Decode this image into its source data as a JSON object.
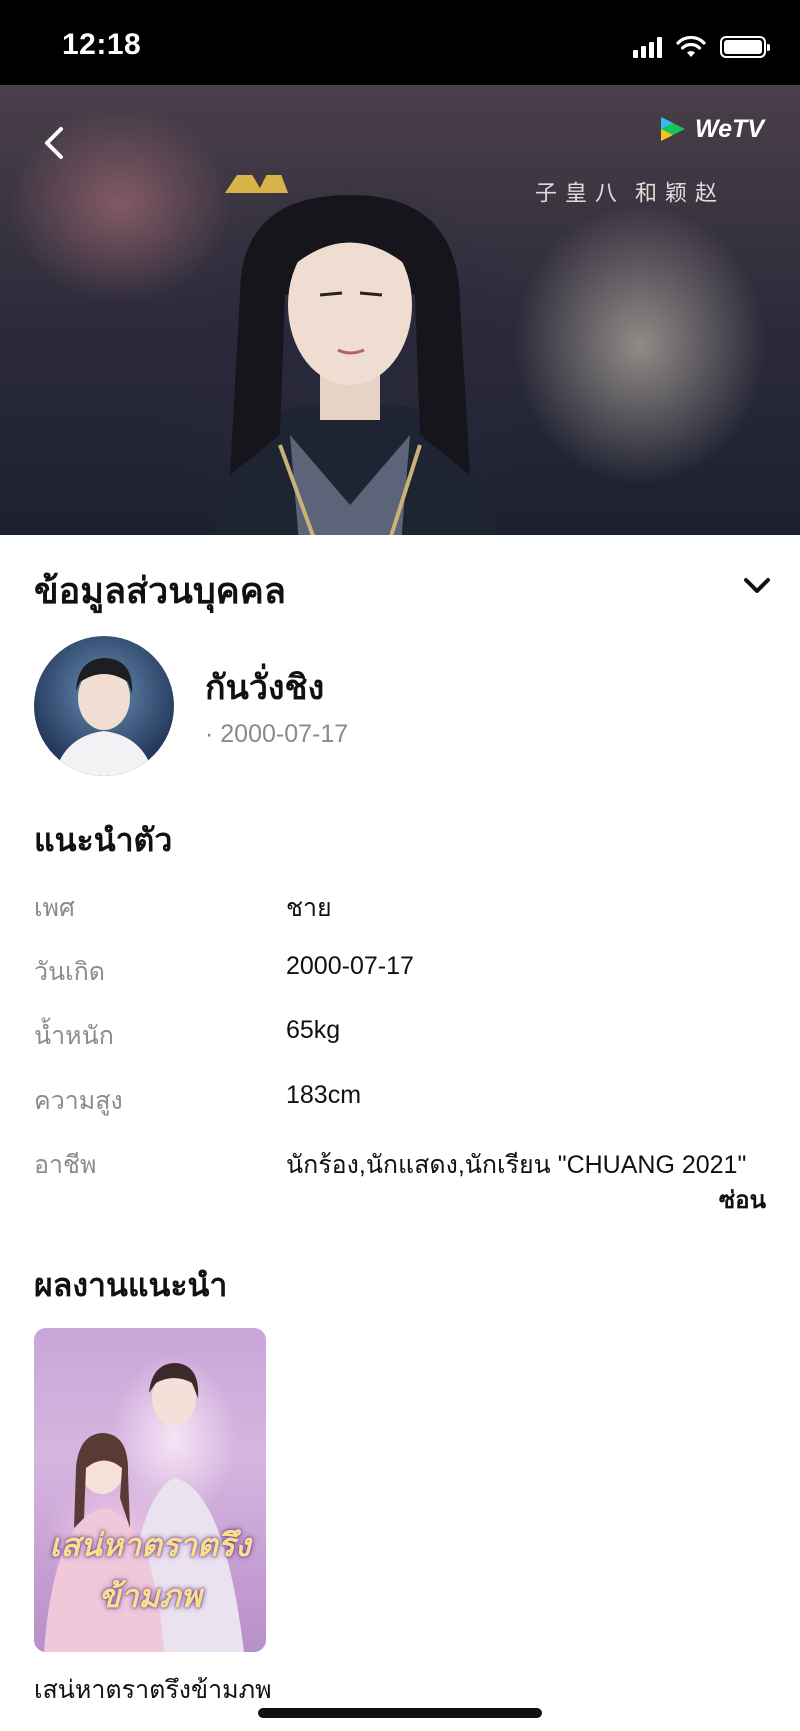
{
  "status_bar": {
    "time": "12:18"
  },
  "hero": {
    "brand": "WeTV",
    "calligraphy": [
      "赵",
      "颖",
      "和",
      "八",
      "皇",
      "子"
    ]
  },
  "profile": {
    "section_title": "ข้อมูลส่วนบุคคล",
    "name": "กันวั่งชิง",
    "birth_line": "· 2000-07-17"
  },
  "intro": {
    "title": "แนะนำตัว",
    "rows": [
      {
        "label": "เพศ",
        "value": "ชาย"
      },
      {
        "label": "วันเกิด",
        "value": "2000-07-17"
      },
      {
        "label": "น้ำหนัก",
        "value": "65kg"
      },
      {
        "label": "ความสูง",
        "value": "183cm"
      },
      {
        "label": "อาชีพ",
        "value": "นักร้อง,นักแสดง,นักเรียน \"CHUANG 2021\""
      }
    ],
    "hide_label": "ซ่อน"
  },
  "works": {
    "title": "ผลงานแนะนำ",
    "items": [
      {
        "title": "เสน่หาตราตรึงข้ามภพ",
        "poster_art_text": "เสน่หาตราตรึงข้ามภพ"
      }
    ]
  },
  "colors": {
    "status_bar": "#000000",
    "label_gray": "#8c8c8c",
    "text": "#111111",
    "brand_green": "#17c45a"
  }
}
